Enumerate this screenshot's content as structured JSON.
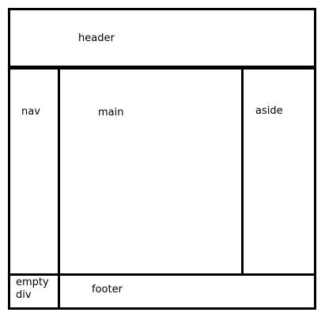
{
  "regions": {
    "header": "header",
    "nav": "nav",
    "main": "main",
    "aside": "aside",
    "empty_div": "empty\ndiv",
    "footer": "footer"
  },
  "colors": {
    "stroke": "#000000",
    "background": "#ffffff"
  }
}
